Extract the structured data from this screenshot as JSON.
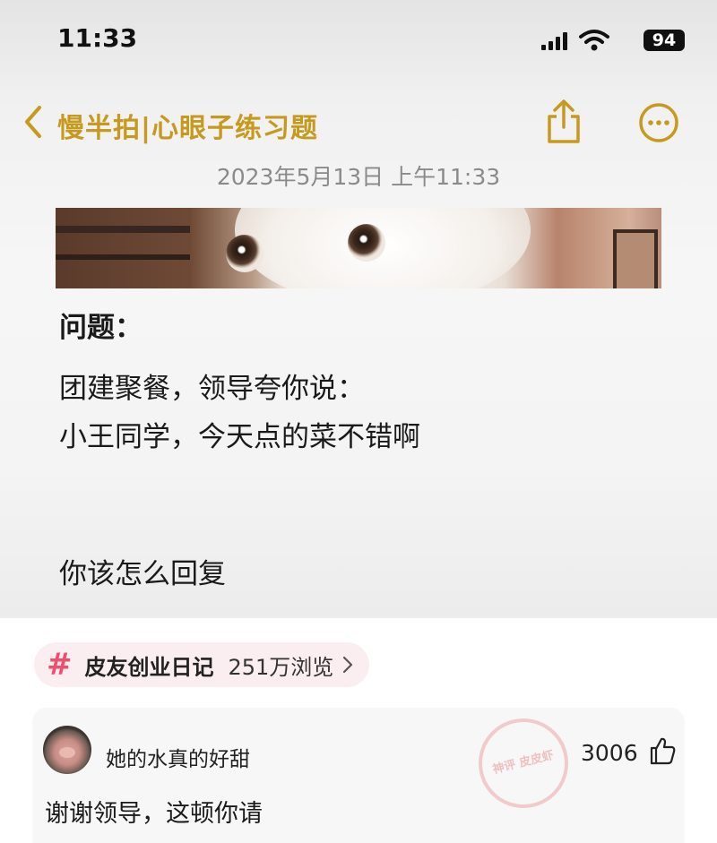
{
  "status_bar": {
    "time": "11:33",
    "battery": "94"
  },
  "note": {
    "folder_title": "慢半拍|心眼子练习题",
    "date": "2023年5月13日 上午11:33",
    "heading": "问题：",
    "line1": "团建聚餐，领导夸你说：",
    "line2": "小王同学，今天点的菜不错啊",
    "line3": "你该怎么回复"
  },
  "topic": {
    "name": "皮友创业日记",
    "views": "251万浏览"
  },
  "comment": {
    "user": "她的水真的好甜",
    "likes": "3006",
    "text": "谢谢领导，这顿你请",
    "watermark": "神评 皮皮虾"
  },
  "colors": {
    "accent": "#c79a1e",
    "topic": "#ef4f6d"
  }
}
